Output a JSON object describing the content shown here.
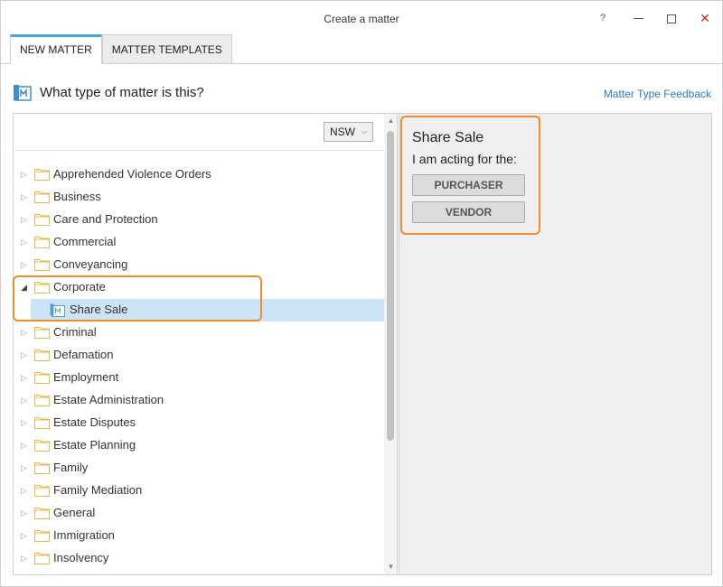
{
  "window": {
    "title": "Create a matter",
    "help_label": "?",
    "close_label": "✕"
  },
  "tabs": [
    {
      "label": "NEW MATTER",
      "active": true
    },
    {
      "label": "MATTER TEMPLATES",
      "active": false
    }
  ],
  "header": {
    "question": "What type of matter is this?",
    "feedback_link": "Matter Type Feedback"
  },
  "region": {
    "selected": "NSW"
  },
  "tree": {
    "items": [
      {
        "label": "Apprehended Violence Orders",
        "expanded": false
      },
      {
        "label": "Business",
        "expanded": false
      },
      {
        "label": "Care and Protection",
        "expanded": false
      },
      {
        "label": "Commercial",
        "expanded": false
      },
      {
        "label": "Conveyancing",
        "expanded": false
      },
      {
        "label": "Corporate",
        "expanded": true
      },
      {
        "label": "Share Sale",
        "child": true,
        "selected": true
      },
      {
        "label": "Criminal",
        "expanded": false
      },
      {
        "label": "Defamation",
        "expanded": false
      },
      {
        "label": "Employment",
        "expanded": false
      },
      {
        "label": "Estate Administration",
        "expanded": false
      },
      {
        "label": "Estate Disputes",
        "expanded": false
      },
      {
        "label": "Estate Planning",
        "expanded": false
      },
      {
        "label": "Family",
        "expanded": false
      },
      {
        "label": "Family Mediation",
        "expanded": false
      },
      {
        "label": "General",
        "expanded": false
      },
      {
        "label": "Immigration",
        "expanded": false
      },
      {
        "label": "Insolvency",
        "expanded": false
      }
    ]
  },
  "detail": {
    "title": "Share Sale",
    "subtitle": "I am acting for the:",
    "buttons": [
      "PURCHASER",
      "VENDOR"
    ]
  },
  "colors": {
    "accent": "#4aa3df",
    "highlight": "#f28c28",
    "selection": "#cce4f7",
    "link": "#2b79c2",
    "folder": "#e8b84a"
  }
}
